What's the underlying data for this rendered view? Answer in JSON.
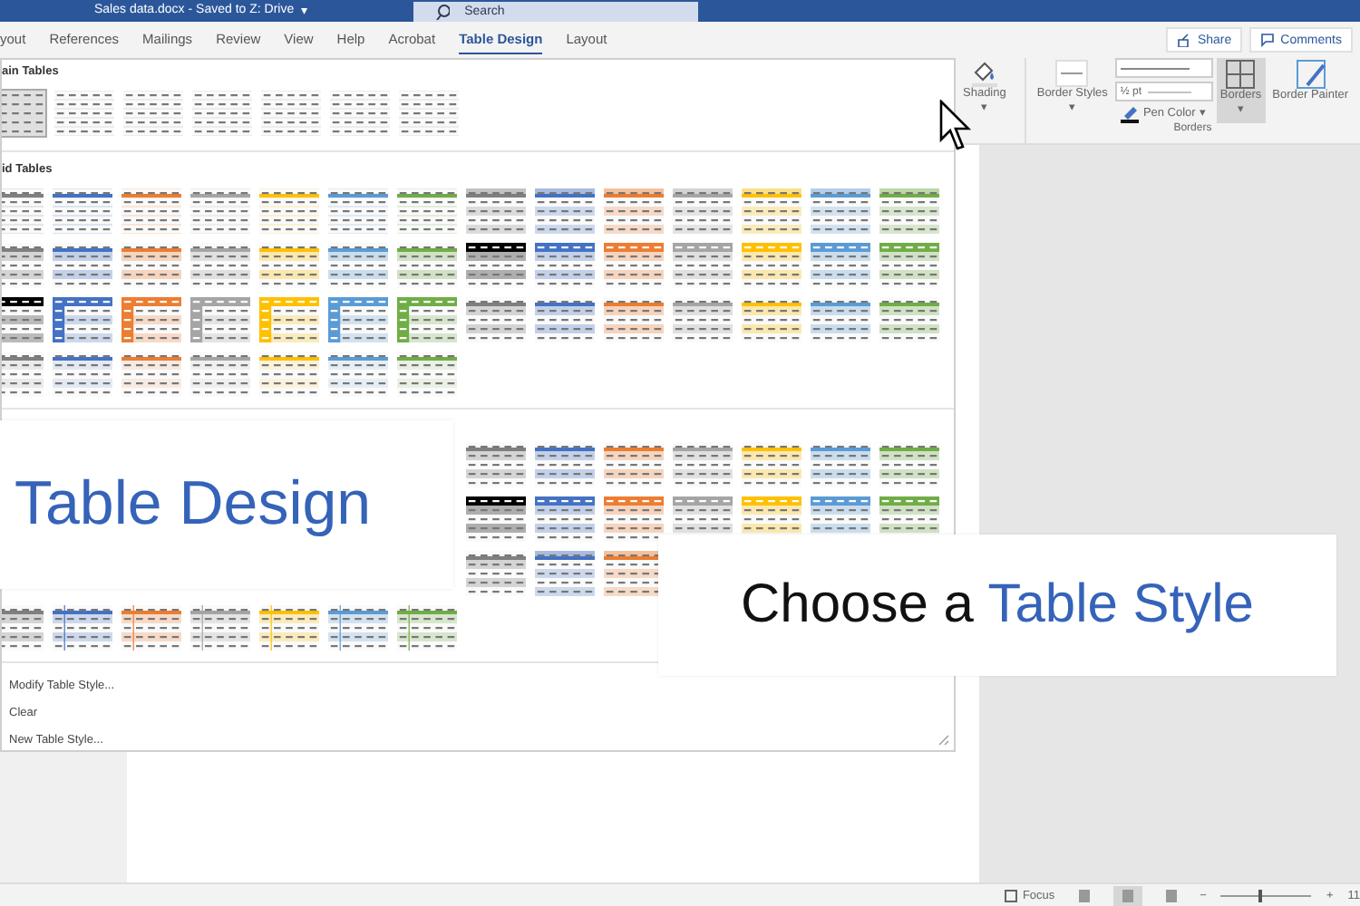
{
  "window": {
    "title": "Sales data.docx  -  Saved to Z: Drive",
    "title_caret": "▾",
    "search": {
      "placeholder": "Search"
    }
  },
  "tabs": [
    {
      "label": "yout",
      "selected": false
    },
    {
      "label": "References",
      "selected": false
    },
    {
      "label": "Mailings",
      "selected": false
    },
    {
      "label": "Review",
      "selected": false
    },
    {
      "label": "View",
      "selected": false
    },
    {
      "label": "Help",
      "selected": false
    },
    {
      "label": "Acrobat",
      "selected": false
    },
    {
      "label": "Table Design",
      "selected": true
    },
    {
      "label": "Layout",
      "selected": false
    }
  ],
  "header_buttons": [
    {
      "label": "Share"
    },
    {
      "label": "Comments"
    }
  ],
  "ribbon": {
    "shading": {
      "label": "Shading",
      "caret": "▾"
    },
    "border_styles": {
      "label": "Border Styles",
      "caret": "▾"
    },
    "weight": {
      "value": "½ pt"
    },
    "pen_color": {
      "label": "Pen Color",
      "caret": "▾"
    },
    "borders": {
      "label": "Borders",
      "caret": "▾"
    },
    "border_painter": {
      "label": "Border Painter"
    },
    "group_label": "Borders"
  },
  "gallery": {
    "sections": [
      {
        "heading": "ain Tables",
        "rows": [
          {
            "items": [
              {
                "kind": "plain",
                "selected": true
              },
              {
                "kind": "plain",
                "selected": false
              },
              {
                "kind": "plain",
                "selected": false
              },
              {
                "kind": "plain",
                "selected": false
              },
              {
                "kind": "plain",
                "selected": false
              },
              {
                "kind": "plain",
                "selected": false
              },
              {
                "kind": "plain",
                "selected": false
              }
            ]
          }
        ]
      },
      {
        "heading": "id Tables",
        "rows": [
          {
            "items": [
              {
                "kind": "grid-light",
                "color": "#7f7f7f",
                "selected": false
              },
              {
                "kind": "grid-light",
                "color": "#4472c4",
                "selected": false
              },
              {
                "kind": "grid-light",
                "color": "#ed7d31",
                "selected": false
              },
              {
                "kind": "grid-light",
                "color": "#a5a5a5",
                "selected": false
              },
              {
                "kind": "grid-light",
                "color": "#ffc000",
                "selected": false
              },
              {
                "kind": "grid-light",
                "color": "#5b9bd5",
                "selected": false
              },
              {
                "kind": "grid-light",
                "color": "#70ad47",
                "selected": false
              },
              {
                "kind": "grid",
                "color": "#7f7f7f",
                "selected": false
              },
              {
                "kind": "grid",
                "color": "#4472c4",
                "selected": false
              },
              {
                "kind": "grid",
                "color": "#ed7d31",
                "selected": false
              },
              {
                "kind": "grid",
                "color": "#a5a5a5",
                "selected": false
              },
              {
                "kind": "grid",
                "color": "#ffc000",
                "selected": false
              },
              {
                "kind": "grid",
                "color": "#5b9bd5",
                "selected": false
              },
              {
                "kind": "grid",
                "color": "#70ad47",
                "selected": false
              }
            ]
          },
          {
            "items": [
              {
                "kind": "banded",
                "color": "#7f7f7f",
                "selected": false
              },
              {
                "kind": "banded",
                "color": "#4472c4",
                "selected": false
              },
              {
                "kind": "banded",
                "color": "#ed7d31",
                "selected": false
              },
              {
                "kind": "banded",
                "color": "#a5a5a5",
                "selected": false
              },
              {
                "kind": "banded",
                "color": "#ffc000",
                "selected": false
              },
              {
                "kind": "banded",
                "color": "#5b9bd5",
                "selected": false
              },
              {
                "kind": "banded",
                "color": "#70ad47",
                "selected": false
              },
              {
                "kind": "header",
                "color": "#000000",
                "selected": false
              },
              {
                "kind": "header",
                "color": "#4472c4",
                "selected": false
              },
              {
                "kind": "header",
                "color": "#ed7d31",
                "selected": false
              },
              {
                "kind": "header",
                "color": "#a5a5a5",
                "selected": false
              },
              {
                "kind": "header",
                "color": "#ffc000",
                "selected": false
              },
              {
                "kind": "header",
                "color": "#5b9bd5",
                "selected": false
              },
              {
                "kind": "header",
                "color": "#70ad47",
                "selected": false
              }
            ]
          },
          {
            "items": [
              {
                "kind": "firstcol",
                "color": "#000000",
                "selected": false
              },
              {
                "kind": "firstcol",
                "color": "#4472c4",
                "selected": false
              },
              {
                "kind": "firstcol",
                "color": "#ed7d31",
                "selected": false
              },
              {
                "kind": "firstcol",
                "color": "#a5a5a5",
                "selected": false
              },
              {
                "kind": "firstcol",
                "color": "#ffc000",
                "selected": false
              },
              {
                "kind": "firstcol",
                "color": "#5b9bd5",
                "selected": false
              },
              {
                "kind": "firstcol",
                "color": "#70ad47",
                "selected": false
              },
              {
                "kind": "banded",
                "color": "#7f7f7f",
                "selected": false
              },
              {
                "kind": "banded",
                "color": "#4472c4",
                "selected": false
              },
              {
                "kind": "banded",
                "color": "#ed7d31",
                "selected": false
              },
              {
                "kind": "banded",
                "color": "#a5a5a5",
                "selected": false
              },
              {
                "kind": "banded",
                "color": "#ffc000",
                "selected": false
              },
              {
                "kind": "banded",
                "color": "#5b9bd5",
                "selected": false
              },
              {
                "kind": "banded",
                "color": "#70ad47",
                "selected": false
              }
            ]
          },
          {
            "items": [
              {
                "kind": "faint",
                "color": "#7f7f7f",
                "selected": false
              },
              {
                "kind": "faint",
                "color": "#4472c4",
                "selected": false
              },
              {
                "kind": "faint",
                "color": "#ed7d31",
                "selected": false
              },
              {
                "kind": "faint",
                "color": "#a5a5a5",
                "selected": false
              },
              {
                "kind": "faint",
                "color": "#ffc000",
                "selected": false
              },
              {
                "kind": "faint",
                "color": "#5b9bd5",
                "selected": false
              },
              {
                "kind": "faint",
                "color": "#70ad47",
                "selected": false
              }
            ]
          }
        ]
      },
      {
        "rows": [
          {
            "right_half": true,
            "items": [
              {
                "kind": "banded",
                "color": "#7f7f7f",
                "selected": false
              },
              {
                "kind": "banded",
                "color": "#4472c4",
                "selected": false
              },
              {
                "kind": "banded",
                "color": "#ed7d31",
                "selected": false
              },
              {
                "kind": "banded",
                "color": "#a5a5a5",
                "selected": false
              },
              {
                "kind": "banded",
                "color": "#ffc000",
                "selected": false
              },
              {
                "kind": "banded",
                "color": "#5b9bd5",
                "selected": false
              },
              {
                "kind": "banded",
                "color": "#70ad47",
                "selected": false
              }
            ]
          },
          {
            "right_half": true,
            "items": [
              {
                "kind": "header",
                "color": "#000000",
                "selected": false
              },
              {
                "kind": "header",
                "color": "#4472c4",
                "selected": false
              },
              {
                "kind": "header",
                "color": "#ed7d31",
                "selected": false
              },
              {
                "kind": "header",
                "color": "#a5a5a5",
                "selected": false
              },
              {
                "kind": "header",
                "color": "#ffc000",
                "selected": false
              },
              {
                "kind": "header",
                "color": "#5b9bd5",
                "selected": false
              },
              {
                "kind": "header",
                "color": "#70ad47",
                "selected": false
              }
            ]
          },
          {
            "right_half": true,
            "items": [
              {
                "kind": "banded",
                "color": "#7f7f7f",
                "selected": false
              },
              {
                "kind": "grid",
                "color": "#4472c4",
                "selected": false
              },
              {
                "kind": "grid",
                "color": "#ed7d31",
                "selected": false
              }
            ]
          },
          {
            "items": [
              {
                "kind": "banded",
                "color": "#7f7f7f",
                "selected": false
              },
              {
                "kind": "lined",
                "color": "#4472c4",
                "selected": false
              },
              {
                "kind": "lined",
                "color": "#ed7d31",
                "selected": false
              },
              {
                "kind": "lined",
                "color": "#a5a5a5",
                "selected": false
              },
              {
                "kind": "lined",
                "color": "#ffc000",
                "selected": false
              },
              {
                "kind": "lined",
                "color": "#5b9bd5",
                "selected": false
              },
              {
                "kind": "lined",
                "color": "#70ad47",
                "selected": false
              }
            ]
          }
        ]
      }
    ],
    "menu": [
      {
        "label": "Modify Table Style..."
      },
      {
        "label": "Clear"
      },
      {
        "label": "New Table Style..."
      }
    ]
  },
  "captions": [
    {
      "text": "Table Design"
    },
    {
      "text": "Choose a",
      "highlight": "Table Style"
    }
  ],
  "status_bar": {
    "focus": "Focus",
    "views": [
      {
        "selected": false
      },
      {
        "selected": true
      },
      {
        "selected": false
      }
    ],
    "zoom_minus": "−",
    "zoom_plus": "+",
    "zoom": {
      "level": 0.42
    },
    "zoom_value": "11"
  }
}
